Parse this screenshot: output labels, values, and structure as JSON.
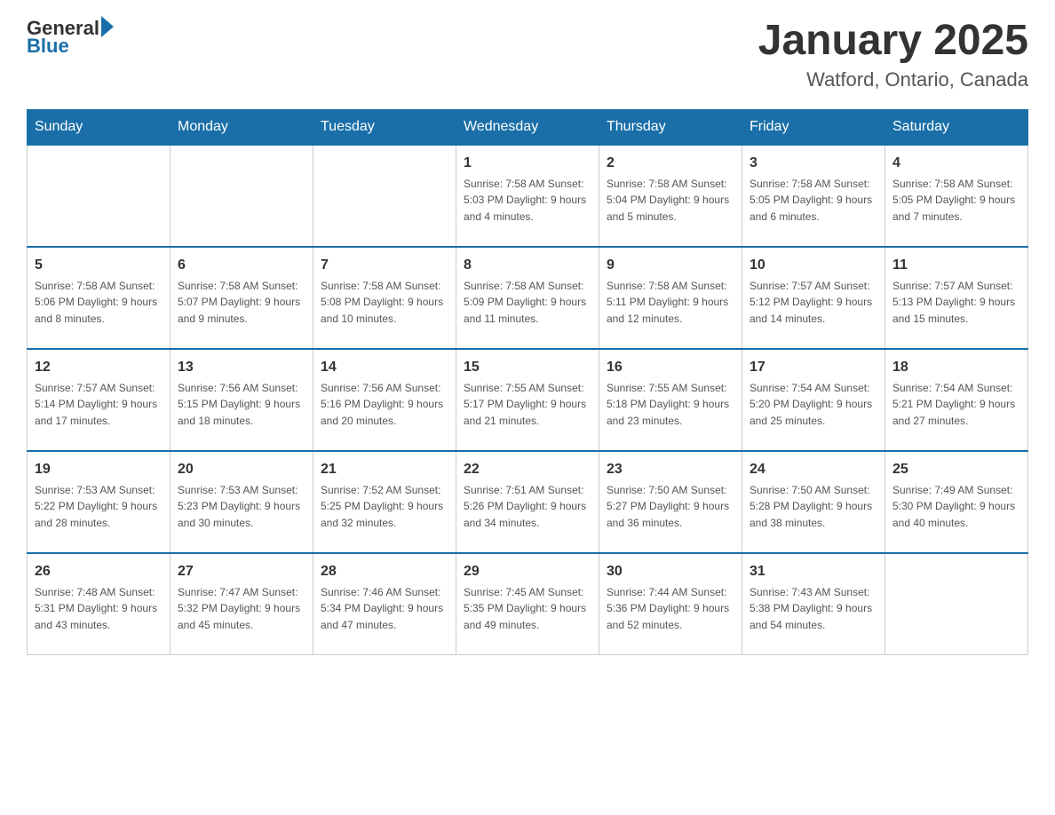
{
  "header": {
    "logo_general": "General",
    "logo_blue": "Blue",
    "month_title": "January 2025",
    "location": "Watford, Ontario, Canada"
  },
  "days_of_week": [
    "Sunday",
    "Monday",
    "Tuesday",
    "Wednesday",
    "Thursday",
    "Friday",
    "Saturday"
  ],
  "weeks": [
    [
      {
        "day": "",
        "info": ""
      },
      {
        "day": "",
        "info": ""
      },
      {
        "day": "",
        "info": ""
      },
      {
        "day": "1",
        "info": "Sunrise: 7:58 AM\nSunset: 5:03 PM\nDaylight: 9 hours\nand 4 minutes."
      },
      {
        "day": "2",
        "info": "Sunrise: 7:58 AM\nSunset: 5:04 PM\nDaylight: 9 hours\nand 5 minutes."
      },
      {
        "day": "3",
        "info": "Sunrise: 7:58 AM\nSunset: 5:05 PM\nDaylight: 9 hours\nand 6 minutes."
      },
      {
        "day": "4",
        "info": "Sunrise: 7:58 AM\nSunset: 5:05 PM\nDaylight: 9 hours\nand 7 minutes."
      }
    ],
    [
      {
        "day": "5",
        "info": "Sunrise: 7:58 AM\nSunset: 5:06 PM\nDaylight: 9 hours\nand 8 minutes."
      },
      {
        "day": "6",
        "info": "Sunrise: 7:58 AM\nSunset: 5:07 PM\nDaylight: 9 hours\nand 9 minutes."
      },
      {
        "day": "7",
        "info": "Sunrise: 7:58 AM\nSunset: 5:08 PM\nDaylight: 9 hours\nand 10 minutes."
      },
      {
        "day": "8",
        "info": "Sunrise: 7:58 AM\nSunset: 5:09 PM\nDaylight: 9 hours\nand 11 minutes."
      },
      {
        "day": "9",
        "info": "Sunrise: 7:58 AM\nSunset: 5:11 PM\nDaylight: 9 hours\nand 12 minutes."
      },
      {
        "day": "10",
        "info": "Sunrise: 7:57 AM\nSunset: 5:12 PM\nDaylight: 9 hours\nand 14 minutes."
      },
      {
        "day": "11",
        "info": "Sunrise: 7:57 AM\nSunset: 5:13 PM\nDaylight: 9 hours\nand 15 minutes."
      }
    ],
    [
      {
        "day": "12",
        "info": "Sunrise: 7:57 AM\nSunset: 5:14 PM\nDaylight: 9 hours\nand 17 minutes."
      },
      {
        "day": "13",
        "info": "Sunrise: 7:56 AM\nSunset: 5:15 PM\nDaylight: 9 hours\nand 18 minutes."
      },
      {
        "day": "14",
        "info": "Sunrise: 7:56 AM\nSunset: 5:16 PM\nDaylight: 9 hours\nand 20 minutes."
      },
      {
        "day": "15",
        "info": "Sunrise: 7:55 AM\nSunset: 5:17 PM\nDaylight: 9 hours\nand 21 minutes."
      },
      {
        "day": "16",
        "info": "Sunrise: 7:55 AM\nSunset: 5:18 PM\nDaylight: 9 hours\nand 23 minutes."
      },
      {
        "day": "17",
        "info": "Sunrise: 7:54 AM\nSunset: 5:20 PM\nDaylight: 9 hours\nand 25 minutes."
      },
      {
        "day": "18",
        "info": "Sunrise: 7:54 AM\nSunset: 5:21 PM\nDaylight: 9 hours\nand 27 minutes."
      }
    ],
    [
      {
        "day": "19",
        "info": "Sunrise: 7:53 AM\nSunset: 5:22 PM\nDaylight: 9 hours\nand 28 minutes."
      },
      {
        "day": "20",
        "info": "Sunrise: 7:53 AM\nSunset: 5:23 PM\nDaylight: 9 hours\nand 30 minutes."
      },
      {
        "day": "21",
        "info": "Sunrise: 7:52 AM\nSunset: 5:25 PM\nDaylight: 9 hours\nand 32 minutes."
      },
      {
        "day": "22",
        "info": "Sunrise: 7:51 AM\nSunset: 5:26 PM\nDaylight: 9 hours\nand 34 minutes."
      },
      {
        "day": "23",
        "info": "Sunrise: 7:50 AM\nSunset: 5:27 PM\nDaylight: 9 hours\nand 36 minutes."
      },
      {
        "day": "24",
        "info": "Sunrise: 7:50 AM\nSunset: 5:28 PM\nDaylight: 9 hours\nand 38 minutes."
      },
      {
        "day": "25",
        "info": "Sunrise: 7:49 AM\nSunset: 5:30 PM\nDaylight: 9 hours\nand 40 minutes."
      }
    ],
    [
      {
        "day": "26",
        "info": "Sunrise: 7:48 AM\nSunset: 5:31 PM\nDaylight: 9 hours\nand 43 minutes."
      },
      {
        "day": "27",
        "info": "Sunrise: 7:47 AM\nSunset: 5:32 PM\nDaylight: 9 hours\nand 45 minutes."
      },
      {
        "day": "28",
        "info": "Sunrise: 7:46 AM\nSunset: 5:34 PM\nDaylight: 9 hours\nand 47 minutes."
      },
      {
        "day": "29",
        "info": "Sunrise: 7:45 AM\nSunset: 5:35 PM\nDaylight: 9 hours\nand 49 minutes."
      },
      {
        "day": "30",
        "info": "Sunrise: 7:44 AM\nSunset: 5:36 PM\nDaylight: 9 hours\nand 52 minutes."
      },
      {
        "day": "31",
        "info": "Sunrise: 7:43 AM\nSunset: 5:38 PM\nDaylight: 9 hours\nand 54 minutes."
      },
      {
        "day": "",
        "info": ""
      }
    ]
  ]
}
